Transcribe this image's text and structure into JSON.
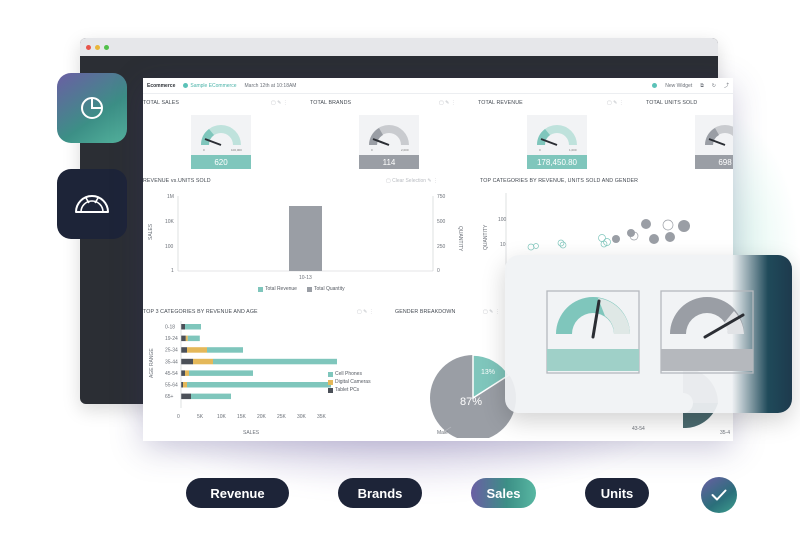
{
  "dashboard": {
    "brand": "Ecommerce",
    "breadcrumb": "Sample ECommerce",
    "timestamp": "March 12th at 10:18AM",
    "new_widget": "New Widget"
  },
  "widgets": {
    "total_sales": {
      "title": "TOTAL SALES",
      "value": "620",
      "max": "100,000"
    },
    "total_brands": {
      "title": "TOTAL BRANDS",
      "value": "114",
      "max": "2,000"
    },
    "total_revenue": {
      "title": "TOTAL REVENUE",
      "value": "178,450.80",
      "max": "1,000"
    },
    "total_units": {
      "title": "TOTAL UNITS SOLD",
      "value": "698"
    },
    "rev_units": {
      "title": "REVENUE vs.UNITS SOLD",
      "clear": "Clear Selection",
      "ylabel": "SALES",
      "y2label": "QUANTITY",
      "yticks": [
        "1M",
        "10K",
        "100",
        "1"
      ],
      "y2ticks": [
        "750",
        "500",
        "250",
        "0"
      ],
      "xtick": "10-13",
      "legend": [
        "Total Revenue",
        "Total Quantity"
      ]
    },
    "top_categories": {
      "title": "TOP CATEGORIES BY REVENUE, UNITS SOLD AND GENDER",
      "ylabel": "QUANTITY",
      "yticks": [
        "100",
        "10"
      ]
    },
    "top3": {
      "title": "TOP 3 CATEGORIES BY REVENUE AND AGE",
      "ylabel": "AGE RANGE",
      "xlabel": "SALES",
      "ages": [
        "0-18",
        "19-24",
        "25-34",
        "35-44",
        "45-54",
        "55-64",
        "65+"
      ],
      "xticks": [
        "0",
        "5K",
        "10K",
        "15K",
        "20K",
        "25K",
        "30K",
        "35K"
      ],
      "legend": [
        "Cell Phones",
        "Digital Cameras",
        "Tablet PCs"
      ]
    },
    "gender": {
      "title": "GENDER BREAKDOWN",
      "big_pct": "87%",
      "small_pct": "13%",
      "male_label": "Male",
      "age_labels": [
        "43-54",
        "35-4"
      ]
    }
  },
  "chart_data": [
    {
      "type": "bar",
      "title": "TOP 3 CATEGORIES BY REVENUE AND AGE",
      "categories": [
        "0-18",
        "19-24",
        "25-34",
        "35-44",
        "45-54",
        "55-64",
        "65+"
      ],
      "series": [
        {
          "name": "Tablet PCs",
          "values": [
            1000,
            1200,
            1500,
            3000,
            1000,
            500,
            2500
          ]
        },
        {
          "name": "Digital Cameras",
          "values": [
            0,
            500,
            5000,
            5000,
            1000,
            1000,
            0
          ]
        },
        {
          "name": "Cell Phones",
          "values": [
            4000,
            3000,
            9000,
            31000,
            16000,
            36000,
            10000
          ]
        }
      ],
      "xlabel": "SALES",
      "ylabel": "AGE RANGE",
      "xlim": [
        0,
        35000
      ]
    },
    {
      "type": "bar",
      "title": "REVENUE vs.UNITS SOLD",
      "categories": [
        "10-13"
      ],
      "series": [
        {
          "name": "Total Quantity",
          "values": [
            650
          ]
        }
      ],
      "ylim": [
        0,
        750
      ]
    },
    {
      "type": "pie",
      "title": "GENDER BREAKDOWN",
      "labels": [
        "Male",
        ""
      ],
      "values": [
        87,
        13
      ]
    }
  ],
  "buttons": {
    "revenue": "Revenue",
    "brands": "Brands",
    "sales": "Sales",
    "units": "Units"
  },
  "colors": {
    "teal": "#7fc6bc",
    "gray": "#9a9ea5",
    "gold": "#e4b85a",
    "navy": "#1d2438"
  }
}
